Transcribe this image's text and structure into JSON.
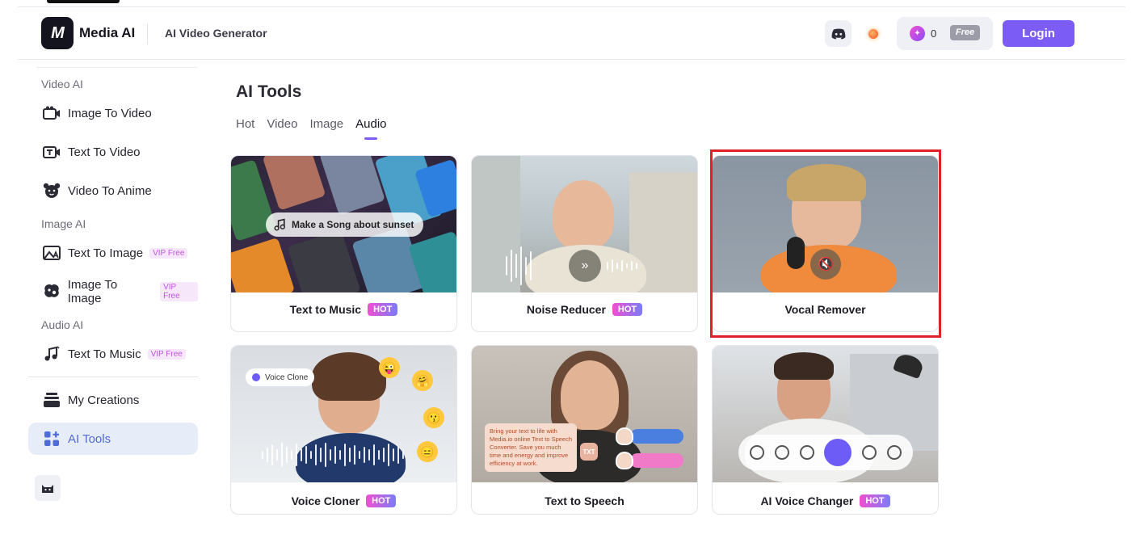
{
  "header": {
    "brand": "Media AI",
    "logo_text": "M",
    "subtitle": "AI Video Generator",
    "credits_count": "0",
    "plan_badge": "Free",
    "login_label": "Login",
    "icons": {
      "discord": "discord-icon",
      "notification": "notification-dot-icon",
      "credits": "credit-gem-icon"
    }
  },
  "sidebar": {
    "sections": [
      {
        "label": "Video AI"
      },
      {
        "label": "Image AI"
      },
      {
        "label": "Audio AI"
      }
    ],
    "items": [
      {
        "label": "Image To Video",
        "icon": "image-to-video-icon",
        "badge": ""
      },
      {
        "label": "Text To Video",
        "icon": "text-to-video-icon",
        "badge": ""
      },
      {
        "label": "Video To Anime",
        "icon": "anime-face-icon",
        "badge": ""
      },
      {
        "label": "Text To Image",
        "icon": "text-to-image-icon",
        "badge": "VIP Free"
      },
      {
        "label": "Image To Image",
        "icon": "image-to-image-icon",
        "badge": "VIP Free"
      },
      {
        "label": "Text To Music",
        "icon": "music-note-icon",
        "badge": "VIP Free"
      },
      {
        "label": "My Creations",
        "icon": "stack-icon",
        "badge": ""
      },
      {
        "label": "AI Tools",
        "icon": "grid-plus-icon",
        "badge": ""
      }
    ],
    "active_item": "AI Tools",
    "bottom_icon": "cat-icon"
  },
  "main": {
    "title": "AI Tools",
    "tabs": [
      {
        "label": "Hot"
      },
      {
        "label": "Video"
      },
      {
        "label": "Image"
      },
      {
        "label": "Audio"
      }
    ],
    "active_tab": "Audio",
    "cards": [
      {
        "title": "Text to Music",
        "badge": "HOT",
        "overlay_text": "Make a Song about sunset"
      },
      {
        "title": "Noise Reducer",
        "badge": "HOT"
      },
      {
        "title": "Vocal Remover",
        "badge": ""
      },
      {
        "title": "Voice Cloner",
        "badge": "HOT",
        "overlay_text": "Voice Clone"
      },
      {
        "title": "Text to Speech",
        "badge": "",
        "overlay_text": "Bring your text to life with Media.io online Text to Speech Converter. Save you much time and energy and improve efficiency at work.",
        "chip_text": "TXT"
      },
      {
        "title": "AI Voice Changer",
        "badge": "HOT"
      }
    ]
  },
  "colors": {
    "accent": "#7b5cf5",
    "active_sidebar_bg": "#e7ecf9",
    "highlight_border": "#e0202a"
  }
}
